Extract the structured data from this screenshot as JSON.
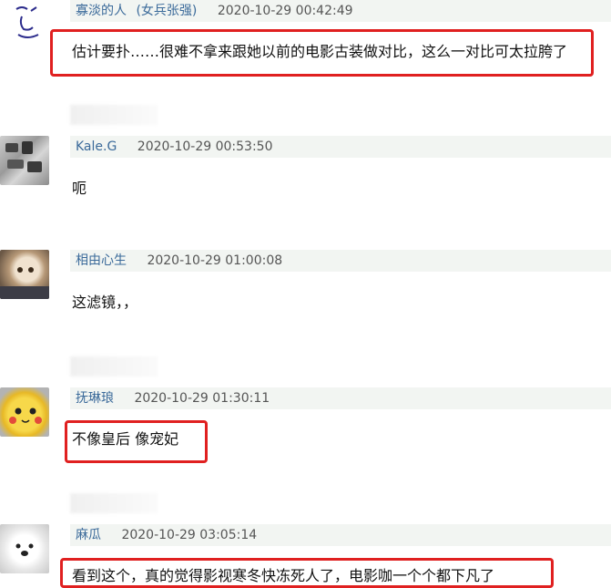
{
  "comments": [
    {
      "username": "寡淡的人",
      "tag": "(女兵张强)",
      "time": "2020-10-29 00:42:49",
      "text": "估计要扑……很难不拿来跟她以前的电影古装做对比，这么一对比可太拉胯了"
    },
    {
      "username": "Kale.G",
      "time": "2020-10-29 00:53:50",
      "text": "呃"
    },
    {
      "username": "相由心生",
      "time": "2020-10-29 01:00:08",
      "text": "这滤镜，，"
    },
    {
      "username": "抚琳琅",
      "time": "2020-10-29 01:30:11",
      "text": "不像皇后 像宠妃"
    },
    {
      "username": "麻瓜",
      "time": "2020-10-29 03:05:14",
      "text": "看到这个，真的觉得影视寒冬快冻死人了，电影咖一个个都下凡了"
    }
  ],
  "colors": {
    "highlight": "#e02020",
    "username": "#3b6a9a",
    "header_bg": "#f2f5f2"
  }
}
